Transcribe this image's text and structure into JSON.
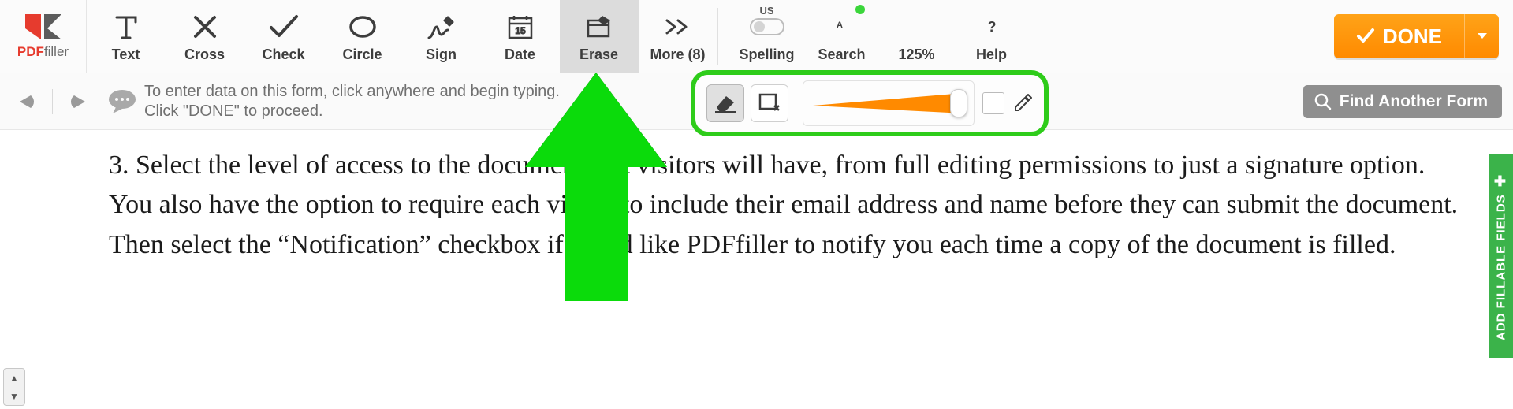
{
  "logo": {
    "brand_red": "PDF",
    "brand_gray": "filler"
  },
  "tools": {
    "text": {
      "label": "Text"
    },
    "cross": {
      "label": "Cross"
    },
    "check": {
      "label": "Check"
    },
    "circle": {
      "label": "Circle"
    },
    "sign": {
      "label": "Sign"
    },
    "date": {
      "label": "Date"
    },
    "erase": {
      "label": "Erase"
    },
    "more": {
      "label": "More (8)"
    }
  },
  "rtools": {
    "spelling": {
      "label": "Spelling",
      "caption": "US"
    },
    "search": {
      "label": "Search"
    },
    "zoom": {
      "label": "125%"
    },
    "help": {
      "label": "Help"
    }
  },
  "done_label": "DONE",
  "hint_line1": "To enter data on this form, click anywhere and begin typing.",
  "hint_line2": "Click \"DONE\" to proceed.",
  "find_label": "Find Another Form",
  "side_tab": "ADD FILLABLE FIELDS",
  "doc_text": "3. Select the level of access to the document that visitors will have, from full editing permissions to just a signature option. You also have the option to require each visitor to include their email address and name before they can submit the document. Then select the “Notification” checkbox if you’d like PDFfiller to notify you each time a copy of the document is filled.",
  "colors": {
    "accent_orange": "#ff8a00",
    "highlight_green": "#2ecc1a",
    "logo_red": "#e63b2e"
  }
}
